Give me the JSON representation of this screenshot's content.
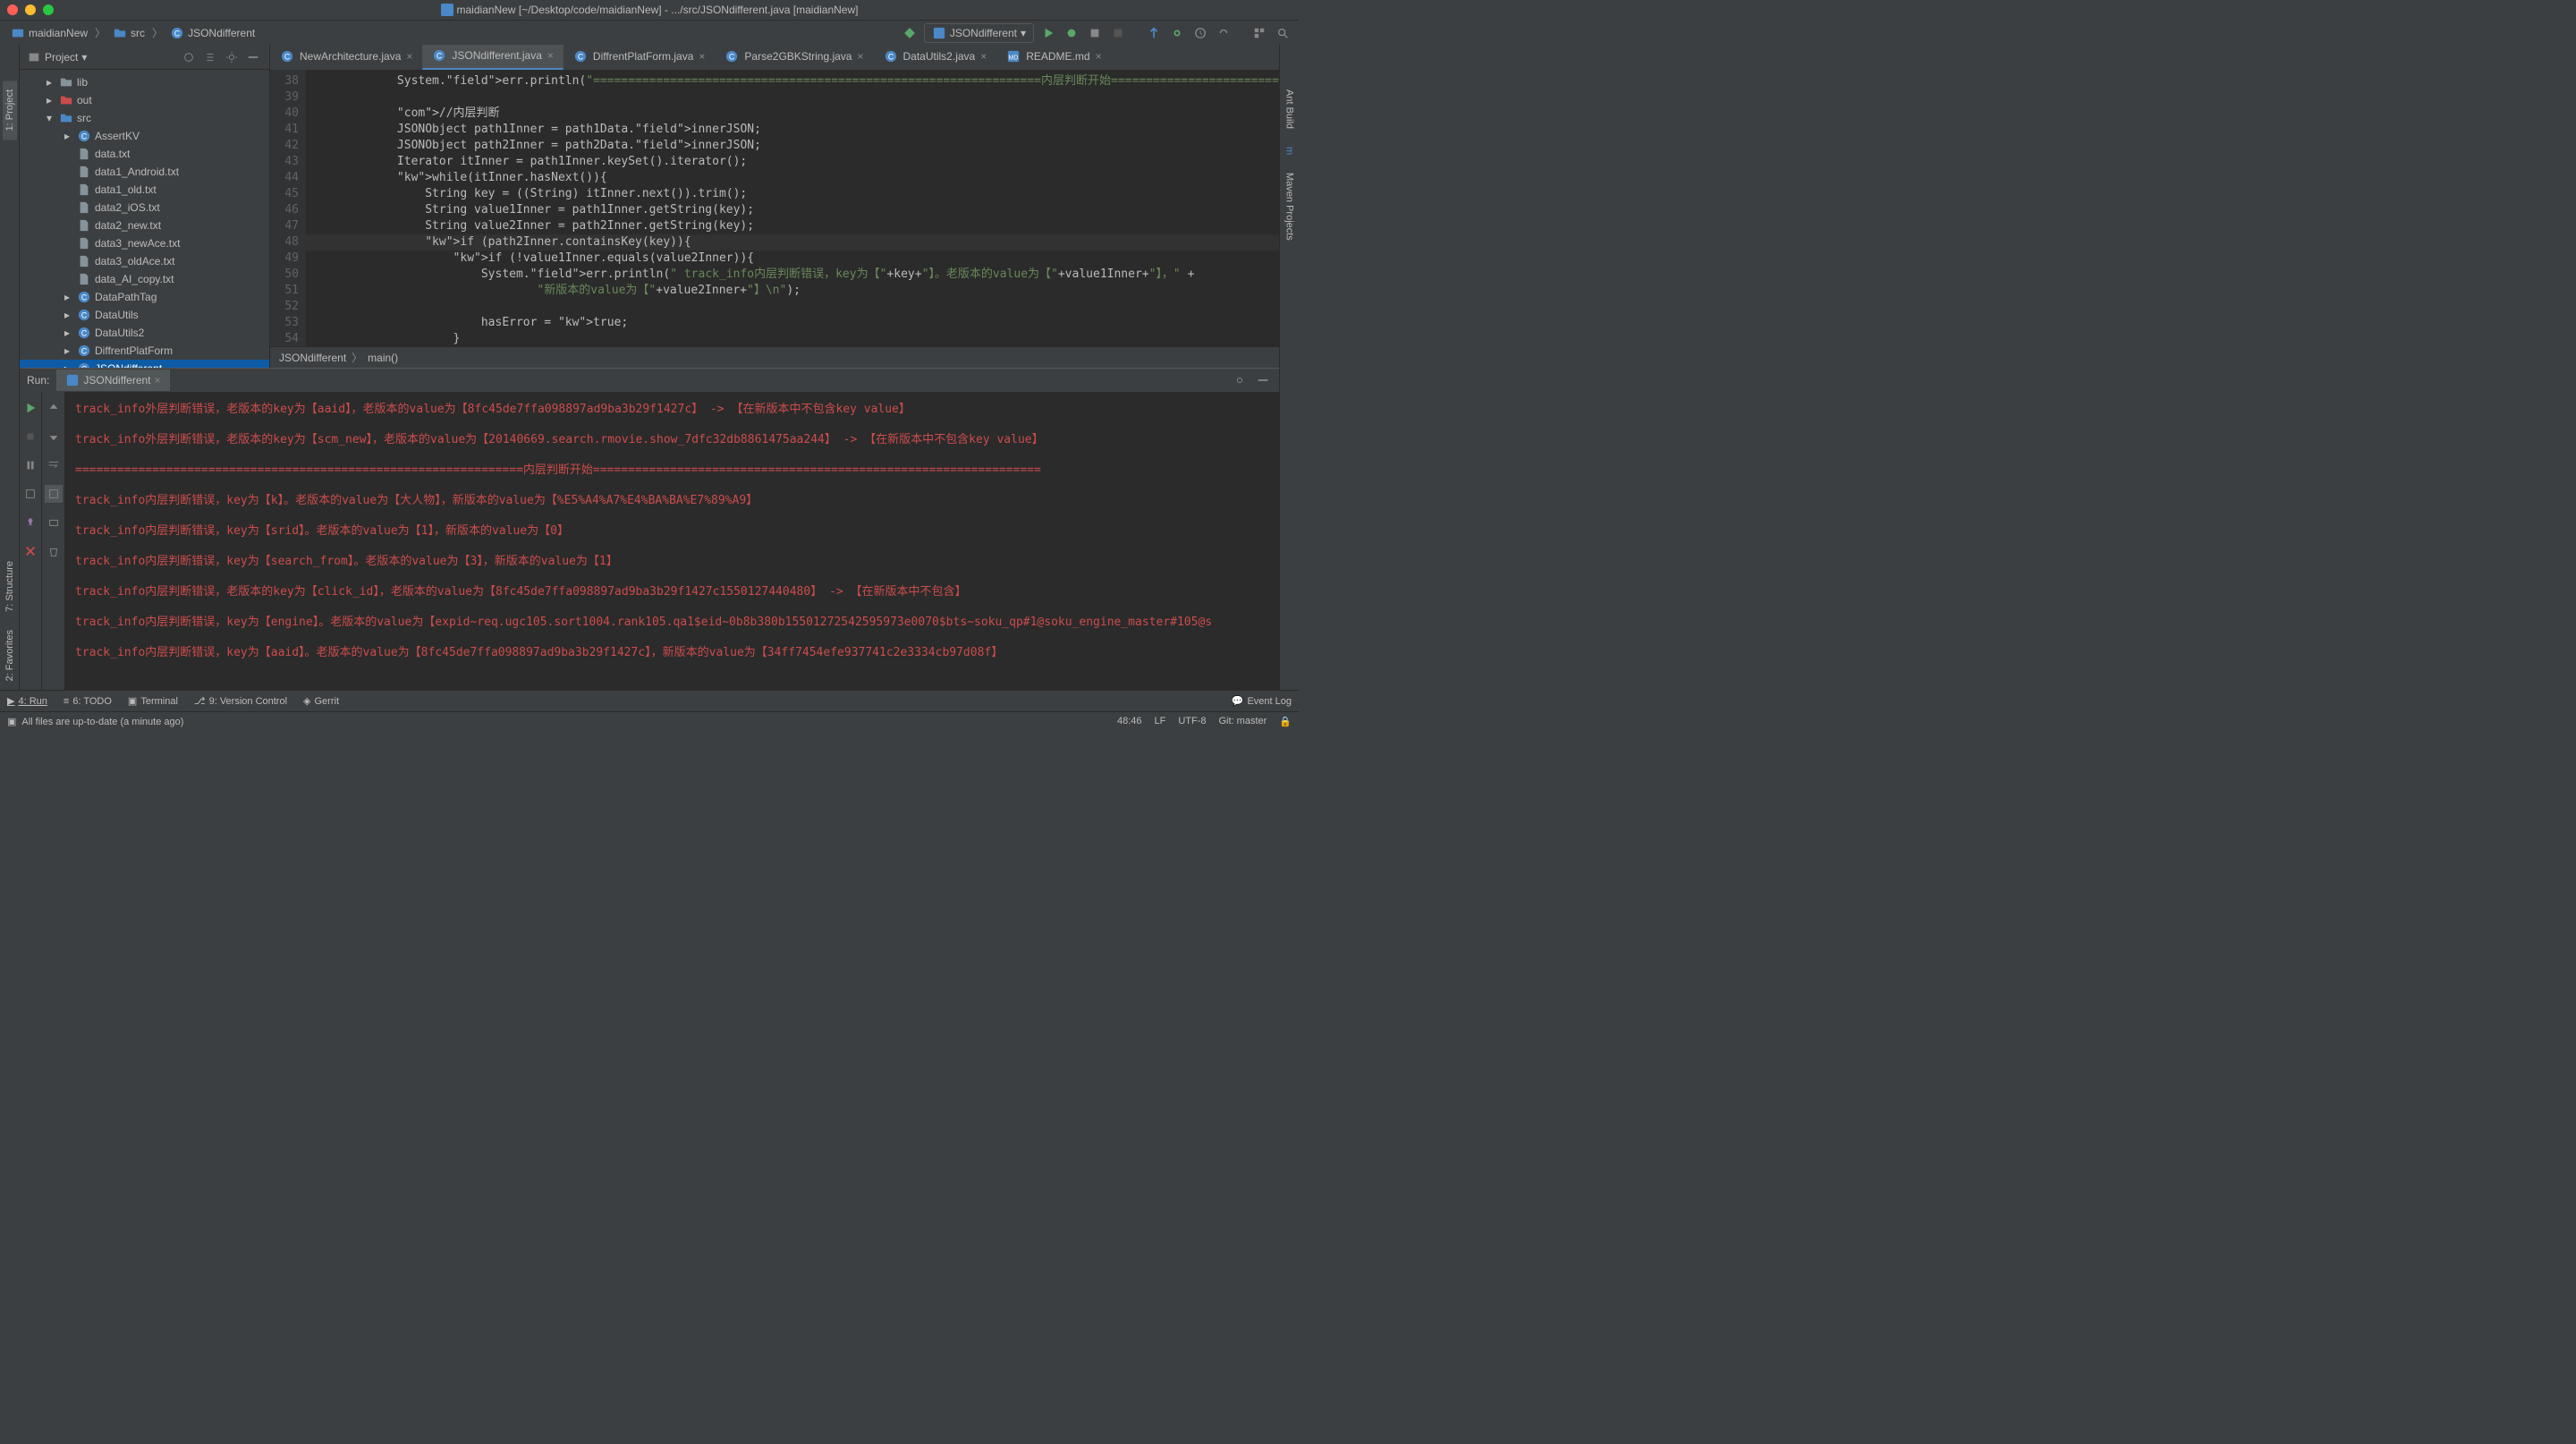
{
  "window": {
    "title": "maidianNew [~/Desktop/code/maidianNew] - .../src/JSONdifferent.java [maidianNew]"
  },
  "breadcrumb": {
    "project": "maidianNew",
    "folder": "src",
    "file": "JSONdifferent"
  },
  "runConfig": "JSONdifferent",
  "sidebar": {
    "title": "Project",
    "items": [
      {
        "label": "lib",
        "type": "folder",
        "indent": 1,
        "expandable": true
      },
      {
        "label": "out",
        "type": "folder-out",
        "indent": 1,
        "expandable": true
      },
      {
        "label": "src",
        "type": "folder-src",
        "indent": 1,
        "expandable": true,
        "expanded": true
      },
      {
        "label": "AssertKV",
        "type": "class",
        "indent": 2,
        "expandable": true
      },
      {
        "label": "data.txt",
        "type": "file",
        "indent": 2
      },
      {
        "label": "data1_Android.txt",
        "type": "file",
        "indent": 2
      },
      {
        "label": "data1_old.txt",
        "type": "file",
        "indent": 2
      },
      {
        "label": "data2_iOS.txt",
        "type": "file",
        "indent": 2
      },
      {
        "label": "data2_new.txt",
        "type": "file",
        "indent": 2
      },
      {
        "label": "data3_newAce.txt",
        "type": "file",
        "indent": 2
      },
      {
        "label": "data3_oldAce.txt",
        "type": "file",
        "indent": 2
      },
      {
        "label": "data_AI_copy.txt",
        "type": "file",
        "indent": 2
      },
      {
        "label": "DataPathTag",
        "type": "class",
        "indent": 2,
        "expandable": true
      },
      {
        "label": "DataUtils",
        "type": "class",
        "indent": 2,
        "expandable": true
      },
      {
        "label": "DataUtils2",
        "type": "class",
        "indent": 2,
        "expandable": true
      },
      {
        "label": "DiffrentPlatForm",
        "type": "class",
        "indent": 2,
        "expandable": true
      },
      {
        "label": "JSONdifferent",
        "type": "class",
        "indent": 2,
        "expandable": true,
        "selected": true
      }
    ]
  },
  "tabs": [
    {
      "label": "NewArchitecture.java",
      "active": false
    },
    {
      "label": "JSONdifferent.java",
      "active": true
    },
    {
      "label": "DiffrentPlatForm.java",
      "active": false
    },
    {
      "label": "Parse2GBKString.java",
      "active": false
    },
    {
      "label": "DataUtils2.java",
      "active": false
    },
    {
      "label": "README.md",
      "active": false,
      "md": true
    }
  ],
  "code": {
    "startLine": 38,
    "lines": [
      "            System.err.println(\"================================================================内层判断开始================================================================\");",
      "",
      "            //内层判断",
      "            JSONObject path1Inner = path1Data.innerJSON;",
      "            JSONObject path2Inner = path2Data.innerJSON;",
      "            Iterator itInner = path1Inner.keySet().iterator();",
      "            while(itInner.hasNext()){",
      "                String key = ((String) itInner.next()).trim();",
      "                String value1Inner = path1Inner.getString(key);",
      "                String value2Inner = path2Inner.getString(key);",
      "                if (path2Inner.containsKey(key)){",
      "                    if (!value1Inner.equals(value2Inner)){",
      "                        System.err.println(\" track_info内层判断错误，key为【\"+key+\"】。老版本的value为【\"+value1Inner+\"】，\" +",
      "                                \"新版本的value为【\"+value2Inner+\"】\\n\");",
      "",
      "                        hasError = true;",
      "                    }",
      ""
    ]
  },
  "editorBreadcrumb": {
    "class": "JSONdifferent",
    "method": "main()"
  },
  "runPanel": {
    "label": "Run:",
    "tab": "JSONdifferent",
    "output": [
      "track_info外层判断错误，老版本的key为【aaid】，老版本的value为【8fc45de7ffa098897ad9ba3b29f1427c】  ->  【在新版本中不包含key value】",
      "track_info外层判断错误，老版本的key为【scm_new】，老版本的value为【20140669.search.rmovie.show_7dfc32db8861475aa244】  ->  【在新版本中不包含key value】",
      "================================================================内层判断开始================================================================",
      "track_info内层判断错误，key为【k】。老版本的value为【大人物】，新版本的value为【%E5%A4%A7%E4%BA%BA%E7%89%A9】",
      "track_info内层判断错误，key为【srid】。老版本的value为【1】，新版本的value为【0】",
      "track_info内层判断错误，key为【search_from】。老版本的value为【3】，新版本的value为【1】",
      "track_info内层判断错误，老版本的key为【click_id】，老版本的value为【8fc45de7ffa098897ad9ba3b29f1427c1550127440480】  ->  【在新版本中不包含】",
      "track_info内层判断错误，key为【engine】。老版本的value为【expid~req.ugc105.sort1004.rank105.qa1$eid~0b8b380b15501272542595973e0070$bts~soku_qp#1@soku_engine_master#105@s",
      "track_info内层判断错误，key为【aaid】。老版本的value为【8fc45de7ffa098897ad9ba3b29f1427c】，新版本的value为【34ff7454efe937741c2e3334cb97d08f】"
    ]
  },
  "bottomTabs": {
    "run": "4: Run",
    "todo": "6: TODO",
    "terminal": "Terminal",
    "vcs": "9: Version Control",
    "gerrit": "Gerrit",
    "eventlog": "Event Log"
  },
  "status": {
    "msg": "All files are up-to-date (a minute ago)",
    "pos": "48:46",
    "lf": "LF",
    "enc": "UTF-8",
    "git": "Git: master"
  },
  "leftStrip": {
    "project": "1: Project",
    "structure": "7: Structure",
    "favorites": "2: Favorites"
  },
  "rightStrip": {
    "antbuild": "Ant Build",
    "maven": "Maven Projects"
  }
}
